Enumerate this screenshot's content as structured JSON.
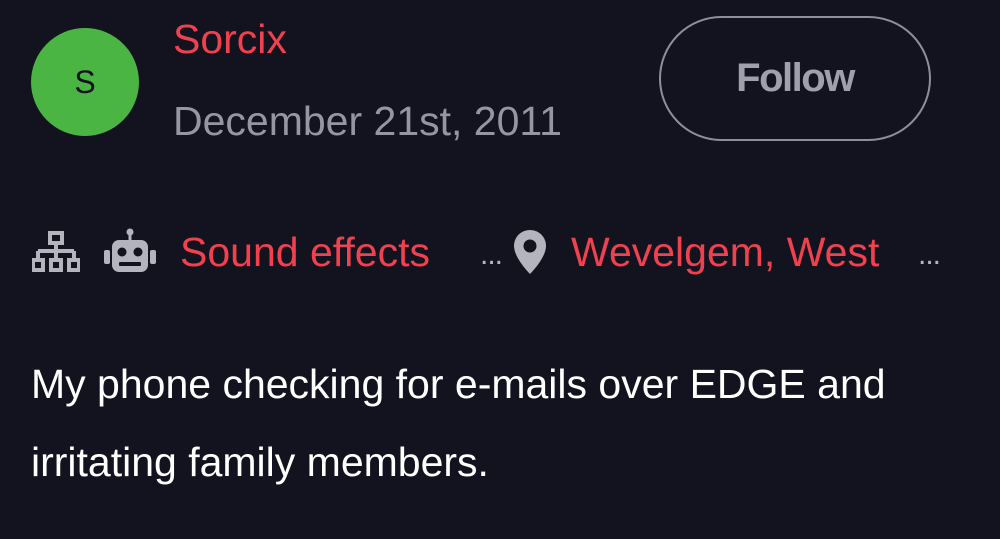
{
  "post": {
    "avatar_letter": "S",
    "avatar_color": "#4bb543",
    "username": "Sorcix",
    "date": "December 21st, 2011",
    "follow_label": "Follow",
    "tags": {
      "hierarchy_icon": "hierarchy-icon",
      "robot_icon": "robot-icon",
      "category": "Sound effects",
      "category_ellipsis": "...",
      "location_icon": "location-pin-icon",
      "location": "Wevelgem, West",
      "location_ellipsis": "..."
    },
    "description": "My phone checking for e-mails over EDGE and irritating family members."
  },
  "colors": {
    "background": "#13131f",
    "accent": "#f0414f",
    "muted": "#9696a3",
    "icon": "#b4b4bf"
  }
}
